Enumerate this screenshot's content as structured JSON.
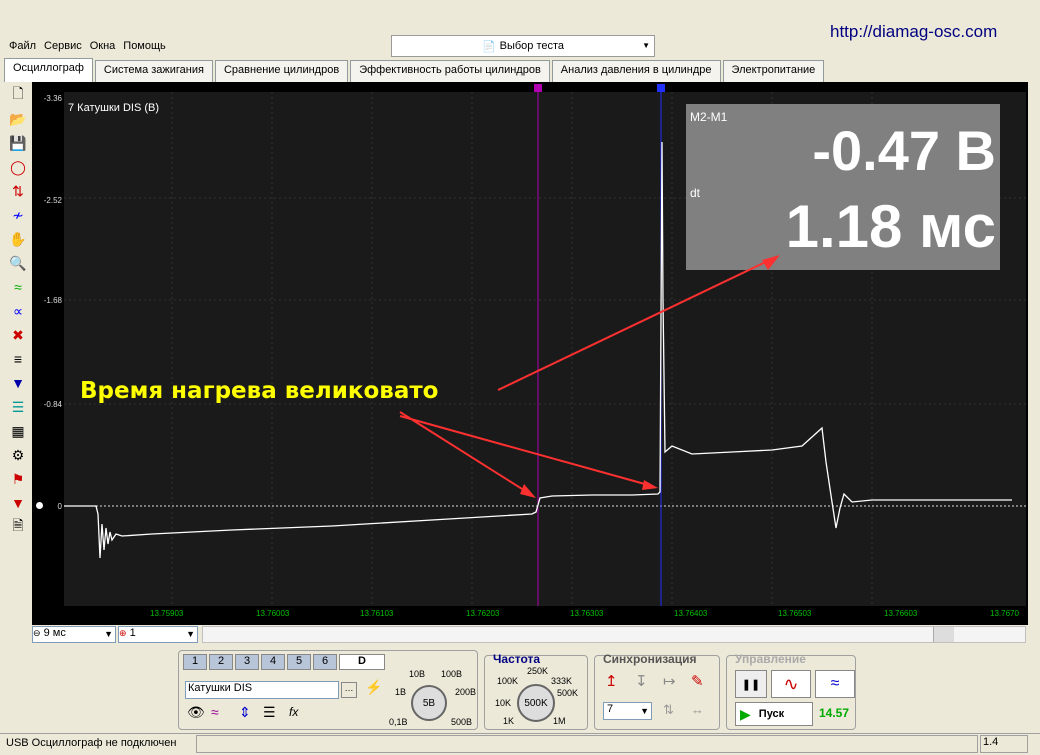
{
  "site_url": "http://diamag-osc.com",
  "menu": [
    "Файл",
    "Сервис",
    "Окна",
    "Помощь"
  ],
  "test_select": {
    "label": "Выбор теста"
  },
  "tabs": [
    "Осциллограф",
    "Система зажигания",
    "Сравнение цилиндров",
    "Эффективность работы цилиндров",
    "Анализ давления в цилиндре",
    "Электропитание"
  ],
  "toolbar_icons": [
    "new-icon",
    "open-icon",
    "save-icon",
    "auto-icon",
    "cursor-measure-icon",
    "wave-icon",
    "hand-icon",
    "zoom-icon",
    "filter-icon",
    "math-icon",
    "fft-icon",
    "markers-icon",
    "channels-icon",
    "list-icon",
    "table-icon",
    "auto-trigger-icon",
    "flag-icon",
    "zero-icon",
    "doc-icon"
  ],
  "plot": {
    "channel_label": "7 Катушки DIS (В)",
    "y_ticks": [
      "-3.36",
      "-2.52",
      "-1.68",
      "-0.84",
      "0"
    ],
    "x_ticks": [
      "13.75903",
      "13.76003",
      "13.76103",
      "13.76203",
      "13.76303",
      "13.76403",
      "13.76503",
      "13.76603",
      "13.7670"
    ],
    "markers": [
      "1",
      "2"
    ],
    "measurement": {
      "title": "M2-M1",
      "value1": "-0.47 В",
      "dt_label": "dt",
      "value2": "1.18 мс"
    },
    "annotation": "Время нагрева великовато"
  },
  "scroll": {
    "timebase": "9 мс",
    "channel": "1"
  },
  "channels_panel": {
    "tabs": [
      "1",
      "2",
      "3",
      "4",
      "5",
      "6",
      "D"
    ],
    "channel_name": "Катушки DIS",
    "volt_labels": [
      "10В",
      "100В",
      "1В",
      "200В",
      "0,1В",
      "500В"
    ],
    "volt_value": "5В"
  },
  "freq_panel": {
    "title": "Частота",
    "labels": [
      "250K",
      "100K",
      "333K",
      "10K",
      "500K",
      "1K",
      "1M"
    ],
    "value": "500K"
  },
  "sync_panel": {
    "title": "Синхронизация",
    "channel": "7"
  },
  "control_panel": {
    "title": "Управление",
    "start": "Пуск",
    "value": "14.57"
  },
  "status": {
    "text": "USB Осциллограф не подключен",
    "right": "1.4"
  }
}
